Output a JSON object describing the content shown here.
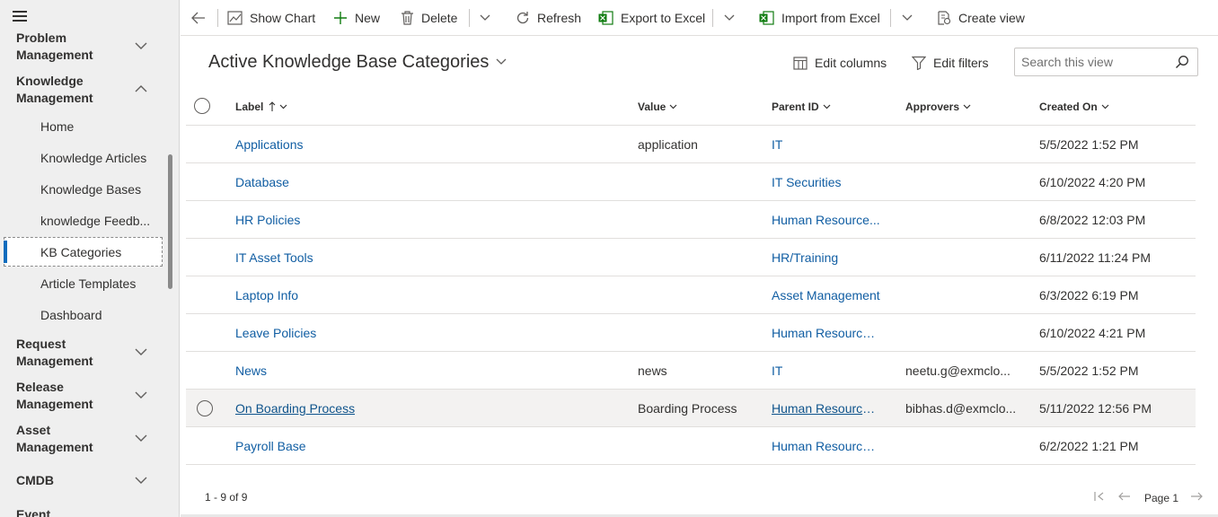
{
  "sidebar": {
    "groups": [
      {
        "label": "Problem Management"
      },
      {
        "label": "Knowledge Management"
      },
      {
        "label": "Request Management"
      },
      {
        "label": "Release Management"
      },
      {
        "label": "Asset Management"
      },
      {
        "label": "CMDB"
      },
      {
        "label": "Event"
      }
    ],
    "sub_items": [
      {
        "label": "Home"
      },
      {
        "label": "Knowledge Articles"
      },
      {
        "label": "Knowledge Bases"
      },
      {
        "label": "knowledge Feedb..."
      },
      {
        "label": "KB Categories"
      },
      {
        "label": "Article Templates"
      },
      {
        "label": "Dashboard"
      }
    ],
    "active_item": "KB Categories"
  },
  "toolbar": {
    "show_chart": "Show Chart",
    "new": "New",
    "delete": "Delete",
    "refresh": "Refresh",
    "export_excel": "Export to Excel",
    "import_excel": "Import from Excel",
    "create_view": "Create view"
  },
  "view": {
    "title": "Active Knowledge Base Categories",
    "edit_columns": "Edit columns",
    "edit_filters": "Edit filters",
    "search_placeholder": "Search this view"
  },
  "grid": {
    "columns": [
      "Label",
      "Value",
      "Parent ID",
      "Approvers",
      "Created On"
    ],
    "rows": [
      {
        "label": "Applications",
        "value": "application",
        "parent": "IT",
        "approvers": "",
        "created": "5/5/2022 1:52 PM"
      },
      {
        "label": "Database",
        "value": "",
        "parent": "IT Securities",
        "approvers": "",
        "created": "6/10/2022 4:20 PM"
      },
      {
        "label": "HR Policies",
        "value": "",
        "parent": "Human Resource...",
        "approvers": "",
        "created": "6/8/2022 12:03 PM"
      },
      {
        "label": "IT Asset Tools",
        "value": "",
        "parent": "HR/Training",
        "approvers": "",
        "created": "6/11/2022 11:24 PM"
      },
      {
        "label": "Laptop Info",
        "value": "",
        "parent": "Asset Management",
        "approvers": "",
        "created": "6/3/2022 6:19 PM"
      },
      {
        "label": "Leave Policies",
        "value": "",
        "parent": "Human Resource ...",
        "approvers": "",
        "created": "6/10/2022 4:21 PM"
      },
      {
        "label": "News",
        "value": "news",
        "parent": "IT",
        "approvers": "neetu.g@exmclo...",
        "created": "5/5/2022 1:52 PM"
      },
      {
        "label": "On Boarding Process",
        "value": "Boarding Process",
        "parent": "Human Resource ...",
        "approvers": "bibhas.d@exmclo...",
        "created": "5/11/2022 12:56 PM"
      },
      {
        "label": "Payroll Base",
        "value": "",
        "parent": "Human Resource ...",
        "approvers": "",
        "created": "6/2/2022 1:21 PM"
      }
    ]
  },
  "footer": {
    "count": "1 - 9 of 9",
    "page": "Page 1"
  }
}
